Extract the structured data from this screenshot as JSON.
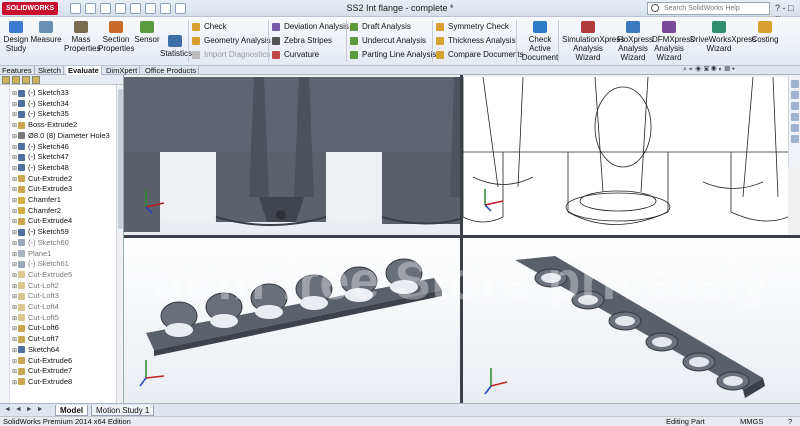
{
  "titlebar": {
    "app_logo": "SOLIDWORKS",
    "doc_title": "SS2 Int flange - complete *",
    "search_placeholder": "Search SolidWorks Help",
    "window_controls": "? - □ ×"
  },
  "ribbon": {
    "large": [
      {
        "id": "design-study",
        "label": "Design Study",
        "icon": "design-study-icon",
        "color": "#3b7bd0"
      },
      {
        "id": "measure",
        "label": "Measure",
        "icon": "ruler-icon",
        "color": "#6a8fb5"
      },
      {
        "id": "mass-properties",
        "label": "Mass Properties",
        "icon": "scale-icon",
        "color": "#7a6a50"
      },
      {
        "id": "section-properties",
        "label": "Section Properties",
        "icon": "section-icon",
        "color": "#c96a2a"
      },
      {
        "id": "sensor",
        "label": "Sensor",
        "icon": "sensor-icon",
        "color": "#5b9b3f"
      },
      {
        "id": "statistics",
        "label": "Statistics",
        "icon": "stats-icon",
        "color": "#3d6ea8"
      },
      {
        "id": "check-active-document",
        "label": "Check Active Document",
        "icon": "check-doc-icon",
        "color": "#2c7bc4"
      },
      {
        "id": "simulationxpress",
        "label": "SimulationXpress Analysis Wizard",
        "icon": "simulation-icon",
        "color": "#b13a3a"
      },
      {
        "id": "floxpress",
        "label": "FloXpress Analysis Wizard",
        "icon": "flow-icon",
        "color": "#3a7bc0"
      },
      {
        "id": "dfmxpress",
        "label": "DFMXpress Analysis Wizard",
        "icon": "dfm-icon",
        "color": "#7a4a9a"
      },
      {
        "id": "driveworksxpress",
        "label": "DriveWorksXpress Wizard",
        "icon": "driveworks-icon",
        "color": "#2f8f6f"
      },
      {
        "id": "costing",
        "label": "Costing",
        "icon": "costing-icon",
        "color": "#d8a030"
      }
    ],
    "small": [
      {
        "id": "check",
        "label": "Check",
        "icon": "check-icon",
        "color": "#d8a030",
        "dim": false
      },
      {
        "id": "geometry-analysis",
        "label": "Geometry Analysis",
        "icon": "geometry-icon",
        "color": "#d8a030",
        "dim": false
      },
      {
        "id": "import-diagnostics",
        "label": "Import Diagnostics",
        "icon": "diagnostics-icon",
        "color": "#bbbbbb",
        "dim": true
      },
      {
        "id": "deviation-analysis",
        "label": "Deviation Analysis",
        "icon": "deviation-icon",
        "color": "#7a5aa8",
        "dim": false
      },
      {
        "id": "zebra-stripes",
        "label": "Zebra Stripes",
        "icon": "zebra-icon",
        "color": "#555555",
        "dim": false
      },
      {
        "id": "curvature",
        "label": "Curvature",
        "icon": "curvature-icon",
        "color": "#c04848",
        "dim": false
      },
      {
        "id": "draft-analysis",
        "label": "Draft Analysis",
        "icon": "draft-icon",
        "color": "#5c9a3c",
        "dim": false
      },
      {
        "id": "undercut-analysis",
        "label": "Undercut Analysis",
        "icon": "undercut-icon",
        "color": "#5c9a3c",
        "dim": false
      },
      {
        "id": "parting-line-analysis",
        "label": "Parting Line Analysis",
        "icon": "parting-icon",
        "color": "#5c9a3c",
        "dim": false
      },
      {
        "id": "symmetry-check",
        "label": "Symmetry Check",
        "icon": "symmetry-icon",
        "color": "#d8a030",
        "dim": false
      },
      {
        "id": "thickness-analysis",
        "label": "Thickness Analysis",
        "icon": "thickness-icon",
        "color": "#d8a030",
        "dim": false
      },
      {
        "id": "compare-documents",
        "label": "Compare Documents",
        "icon": "compare-icon",
        "color": "#d8a030",
        "dim": false
      }
    ]
  },
  "tabs": [
    "Features",
    "Sketch",
    "Evaluate",
    "DimXpert",
    "Office Products"
  ],
  "active_tab": "Evaluate",
  "feature_tree": [
    {
      "label": "(-) Sketch33",
      "icon": "sketch-icon",
      "color": "#4f6f9f",
      "dim": false
    },
    {
      "label": "(-) Sketch34",
      "icon": "sketch-icon",
      "color": "#4f6f9f",
      "dim": false
    },
    {
      "label": "(-) Sketch35",
      "icon": "sketch-icon",
      "color": "#4f6f9f",
      "dim": false
    },
    {
      "label": "Boss-Extrude2",
      "icon": "extrude-icon",
      "color": "#c8a850",
      "dim": false
    },
    {
      "label": "Ø8.0 (8) Diameter Hole3",
      "icon": "hole-icon",
      "color": "#7a7a7a",
      "dim": false
    },
    {
      "label": "(-) Sketch46",
      "icon": "sketch-icon",
      "color": "#4f6f9f",
      "dim": false
    },
    {
      "label": "(-) Sketch47",
      "icon": "sketch-icon",
      "color": "#4f6f9f",
      "dim": false
    },
    {
      "label": "(-) Sketch48",
      "icon": "sketch-icon",
      "color": "#4f6f9f",
      "dim": false
    },
    {
      "label": "Cut-Extrude2",
      "icon": "cut-icon",
      "color": "#c8a850",
      "dim": false
    },
    {
      "label": "Cut-Extrude3",
      "icon": "cut-icon",
      "color": "#c8a850",
      "dim": false
    },
    {
      "label": "Chamfer1",
      "icon": "chamfer-icon",
      "color": "#d4b040",
      "dim": false
    },
    {
      "label": "Chamfer2",
      "icon": "chamfer-icon",
      "color": "#d4b040",
      "dim": false
    },
    {
      "label": "Cut-Extrude4",
      "icon": "cut-icon",
      "color": "#c8a850",
      "dim": false
    },
    {
      "label": "(-) Sketch59",
      "icon": "sketch-icon",
      "color": "#4f6f9f",
      "dim": false
    },
    {
      "label": "(-) Sketch60",
      "icon": "sketch-icon",
      "color": "#9aa8bb",
      "dim": true
    },
    {
      "label": "Plane1",
      "icon": "plane-icon",
      "color": "#a8b4c4",
      "dim": true
    },
    {
      "label": "(-) Sketch61",
      "icon": "sketch-icon",
      "color": "#9aa8bb",
      "dim": true
    },
    {
      "label": "Cut-Extrude5",
      "icon": "cut-icon",
      "color": "#d8c890",
      "dim": true
    },
    {
      "label": "Cut-Loft2",
      "icon": "loft-icon",
      "color": "#d8c890",
      "dim": true
    },
    {
      "label": "Cut-Loft3",
      "icon": "loft-icon",
      "color": "#d8c890",
      "dim": true
    },
    {
      "label": "Cut-Loft4",
      "icon": "loft-icon",
      "color": "#d8c890",
      "dim": true
    },
    {
      "label": "Cut-Loft5",
      "icon": "loft-icon",
      "color": "#d8c890",
      "dim": true
    },
    {
      "label": "Cut-Loft6",
      "icon": "loft-icon",
      "color": "#c8a850",
      "dim": false
    },
    {
      "label": "Cut-Loft7",
      "icon": "loft-icon",
      "color": "#c8a850",
      "dim": false
    },
    {
      "label": "Sketch64",
      "icon": "sketch-icon",
      "color": "#4f6f9f",
      "dim": false
    },
    {
      "label": "Cut-Extrude6",
      "icon": "cut-icon",
      "color": "#c8a850",
      "dim": false
    },
    {
      "label": "Cut-Extrude7",
      "icon": "cut-icon",
      "color": "#c8a850",
      "dim": false
    },
    {
      "label": "Cut-Extrude8",
      "icon": "cut-icon",
      "color": "#c8a850",
      "dim": false
    }
  ],
  "bottom_tabs": [
    "Model",
    "Motion Study 1"
  ],
  "active_bottom_tab": "Model",
  "nav_arrows": "◄ ◄ ► ►",
  "status": {
    "left": "SolidWorks Premium 2014 x64 Edition",
    "mode": "Editing Part",
    "units": "MMGS",
    "help": "?"
  },
  "watermark": "Join free  Store privately"
}
